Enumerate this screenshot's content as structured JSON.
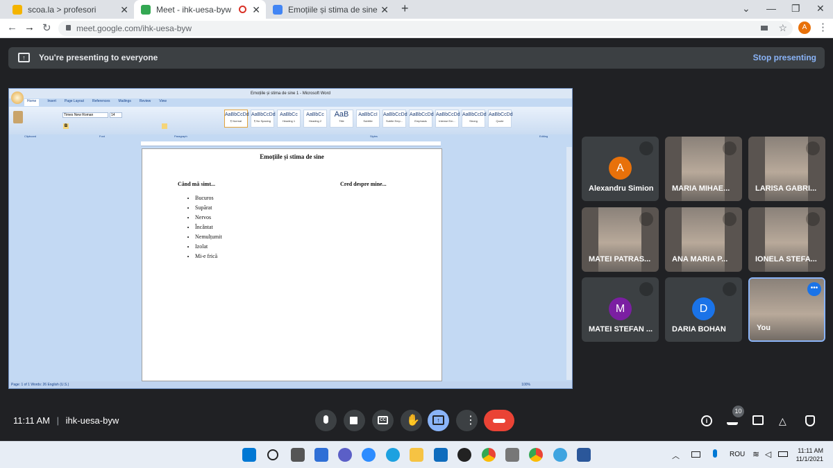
{
  "browser": {
    "tabs": [
      {
        "title": "scoa.la > profesori",
        "active": false
      },
      {
        "title": "Meet - ihk-uesa-byw",
        "active": true
      },
      {
        "title": "Emoțiile și stima de sine",
        "active": false
      }
    ],
    "url": "meet.google.com/ihk-uesa-byw",
    "profile_initial": "A"
  },
  "banner": {
    "text": "You're presenting to everyone",
    "stop_label": "Stop presenting"
  },
  "word": {
    "window_title": "Emoțiile și stima de sine 1 - Microsoft Word",
    "ribbon_tabs": [
      "Home",
      "Insert",
      "Page Layout",
      "References",
      "Mailings",
      "Review",
      "View"
    ],
    "font_name": "Times New Roman",
    "font_size": "14",
    "styles": [
      {
        "preview": "AaBbCcDd",
        "name": "¶ Normal"
      },
      {
        "preview": "AaBbCcDd",
        "name": "¶ No Spacing"
      },
      {
        "preview": "AaBbCc",
        "name": "Heading 1"
      },
      {
        "preview": "AaBbCc",
        "name": "Heading 2"
      },
      {
        "preview": "AaB",
        "name": "Title"
      },
      {
        "preview": "AaBbCcI",
        "name": "Subtitle"
      },
      {
        "preview": "AaBbCcDd",
        "name": "Subtle Emp..."
      },
      {
        "preview": "AaBbCcDd",
        "name": "Emphasis"
      },
      {
        "preview": "AaBbCcDd",
        "name": "Intense Em..."
      },
      {
        "preview": "AaBbCcDd",
        "name": "Strong"
      },
      {
        "preview": "AaBbCcDd",
        "name": "Quote"
      }
    ],
    "group_labels": [
      "Clipboard",
      "Font",
      "Paragraph",
      "Styles",
      "Editing"
    ],
    "document": {
      "title": "Emoțiile și stima de sine",
      "col1_heading": "Când mă simt...",
      "col2_heading": "Cred despre mine...",
      "items": [
        "Bucuros",
        "Supărat",
        "Nervos",
        "Încântat",
        "Nemulțumit",
        "Izolat",
        "Mi-e frică"
      ]
    },
    "status": "Page: 1 of 1   Words: 26   English (U.S.)",
    "zoom": "100%"
  },
  "participants": [
    {
      "name": "Alexandru Simion",
      "initial": "A",
      "color": "#e8710a",
      "video": false
    },
    {
      "name": "MARIA MIHAE...",
      "initial": "",
      "color": "",
      "video": true
    },
    {
      "name": "LARISA GABRI...",
      "initial": "",
      "color": "",
      "video": true
    },
    {
      "name": "MATEI PATRAS...",
      "initial": "",
      "color": "",
      "video": true
    },
    {
      "name": "ANA MARIA P...",
      "initial": "",
      "color": "",
      "video": true
    },
    {
      "name": "IONELA STEFA...",
      "initial": "",
      "color": "",
      "video": true
    },
    {
      "name": "MATEI STEFAN ...",
      "initial": "M",
      "color": "#7b1fa2",
      "video": false
    },
    {
      "name": "DARIA BOHAN",
      "initial": "D",
      "color": "#1a73e8",
      "video": false
    },
    {
      "name": "You",
      "initial": "",
      "color": "",
      "video": true
    }
  ],
  "meeting": {
    "time": "11:11 AM",
    "separator": "|",
    "code": "ihk-uesa-byw",
    "people_count": "10"
  },
  "taskbar": {
    "lang": "ROU",
    "time": "11:11 AM",
    "date": "11/1/2021"
  },
  "colors": {
    "accent": "#8ab4f8",
    "end_call": "#ea4335",
    "present_active": "#8ab4f8"
  }
}
